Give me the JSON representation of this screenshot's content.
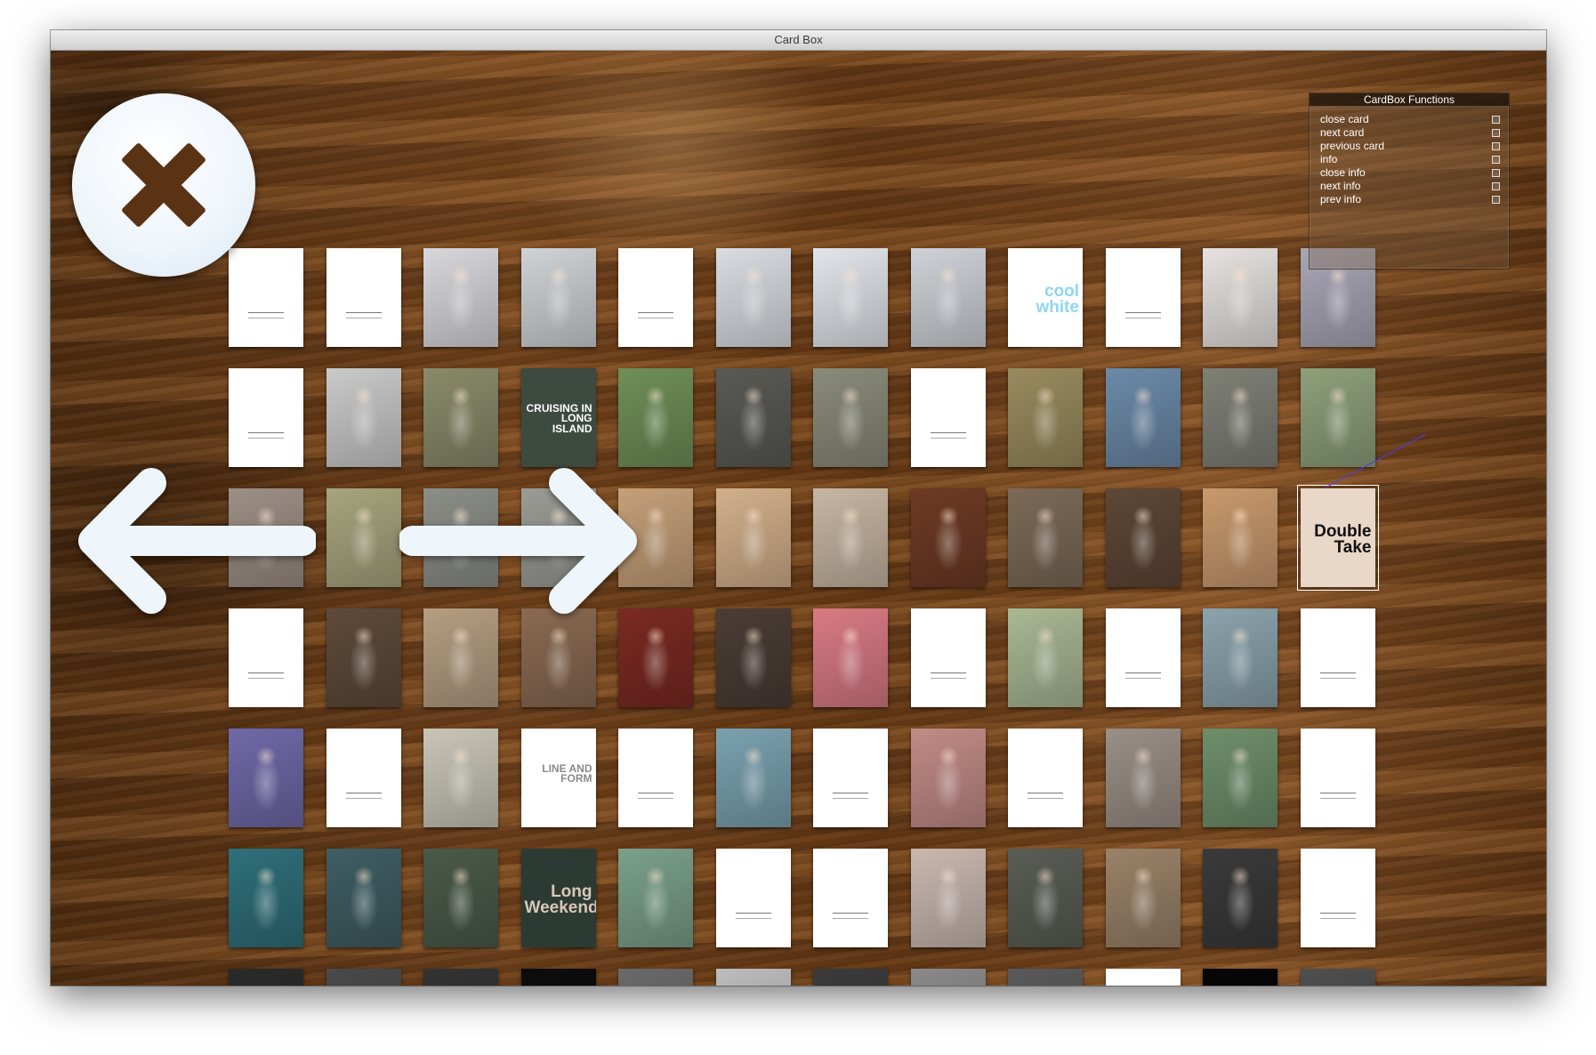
{
  "window": {
    "title": "Card Box"
  },
  "panel": {
    "title": "CardBox Functions",
    "items": [
      {
        "label": "close card"
      },
      {
        "label": "next card"
      },
      {
        "label": "previous card"
      },
      {
        "label": "info"
      },
      {
        "label": "close info"
      },
      {
        "label": "next info"
      },
      {
        "label": "prev info"
      }
    ]
  },
  "icons": {
    "close": "close-x-icon",
    "previous": "arrow-left-icon",
    "next": "arrow-right-icon",
    "status": "small-square-icon"
  },
  "colors": {
    "wood_dark": "#5a3618",
    "wood_light": "#8a5a2c",
    "button_fill": "#eef5fb",
    "x_mark": "#5a3214",
    "pen_line": "#4a3cf0"
  },
  "cards": {
    "rows": 7,
    "columns": 12,
    "selected": {
      "row": 3,
      "column": 12
    },
    "items": [
      [
        {
          "t": "blank"
        },
        {
          "t": "blank"
        },
        {
          "t": "photo",
          "c": "#d8d8dc"
        },
        {
          "t": "photo",
          "c": "#cfd3d6"
        },
        {
          "t": "blank"
        },
        {
          "t": "photo",
          "c": "#d9dde2"
        },
        {
          "t": "photo",
          "c": "#e2e5ea"
        },
        {
          "t": "photo",
          "c": "#cfd2d8"
        },
        {
          "t": "text",
          "text": "cool white",
          "col": "#8fd6f2"
        },
        {
          "t": "blank"
        },
        {
          "t": "photo",
          "c": "#e6e2e0"
        },
        {
          "t": "photo",
          "c": "#a9a6b6"
        }
      ],
      [
        {
          "t": "blank"
        },
        {
          "t": "photo",
          "c": "#cacaca"
        },
        {
          "t": "photo",
          "c": "#8a8a6a"
        },
        {
          "t": "text",
          "text": "CRUISING IN LONG ISLAND",
          "col": "#ffffff",
          "bg": "#3d4a40"
        },
        {
          "t": "photo",
          "c": "#6f8f58"
        },
        {
          "t": "photo",
          "c": "#5a5a55"
        },
        {
          "t": "photo",
          "c": "#8b8b7a"
        },
        {
          "t": "blank"
        },
        {
          "t": "photo",
          "c": "#9a8b5e"
        },
        {
          "t": "photo",
          "c": "#6b8aa8"
        },
        {
          "t": "photo",
          "c": "#7f8076"
        },
        {
          "t": "photo",
          "c": "#8ea07a"
        }
      ],
      [
        {
          "t": "photo",
          "c": "#9c8f86"
        },
        {
          "t": "photo",
          "c": "#a7a57e"
        },
        {
          "t": "photo",
          "c": "#8c8e88"
        },
        {
          "t": "photo",
          "c": "#9b9c96"
        },
        {
          "t": "photo",
          "c": "#c5a079"
        },
        {
          "t": "photo",
          "c": "#d2b08b"
        },
        {
          "t": "photo",
          "c": "#c7b6a2"
        },
        {
          "t": "photo",
          "c": "#6e3a25"
        },
        {
          "t": "photo",
          "c": "#7c6a57"
        },
        {
          "t": "photo",
          "c": "#5e4736"
        },
        {
          "t": "photo",
          "c": "#c9996d"
        },
        {
          "t": "text",
          "text": "Double Take",
          "col": "#111111",
          "bg": "#e9d7c8"
        }
      ],
      [
        {
          "t": "blank"
        },
        {
          "t": "photo",
          "c": "#5e4a3a"
        },
        {
          "t": "photo",
          "c": "#b59e82"
        },
        {
          "t": "photo",
          "c": "#8a6a52"
        },
        {
          "t": "photo",
          "c": "#7a2a22"
        },
        {
          "t": "photo",
          "c": "#4a3d36"
        },
        {
          "t": "photo",
          "c": "#d97a84"
        },
        {
          "t": "blank"
        },
        {
          "t": "photo",
          "c": "#a9b894"
        },
        {
          "t": "blank"
        },
        {
          "t": "photo",
          "c": "#8ba3ad"
        },
        {
          "t": "blank"
        }
      ],
      [
        {
          "t": "photo",
          "c": "#6f69a8"
        },
        {
          "t": "blank"
        },
        {
          "t": "photo",
          "c": "#c9c6b8"
        },
        {
          "t": "text",
          "text": "LINE AND FORM",
          "col": "#8a8a8a"
        },
        {
          "t": "blank"
        },
        {
          "t": "photo",
          "c": "#7aa1b0"
        },
        {
          "t": "blank"
        },
        {
          "t": "photo",
          "c": "#c28b86"
        },
        {
          "t": "blank"
        },
        {
          "t": "photo",
          "c": "#9a8f86"
        },
        {
          "t": "photo",
          "c": "#6e8f6a"
        },
        {
          "t": "blank"
        }
      ],
      [
        {
          "t": "photo",
          "c": "#2f6f7a"
        },
        {
          "t": "photo",
          "c": "#3f5e63"
        },
        {
          "t": "photo",
          "c": "#4a5a4a"
        },
        {
          "t": "text",
          "text": "Long Weekend",
          "col": "#d9c8b8",
          "bg": "#2c3a34"
        },
        {
          "t": "photo",
          "c": "#7aa08a"
        },
        {
          "t": "blank"
        },
        {
          "t": "blank"
        },
        {
          "t": "photo",
          "c": "#c9b8b0"
        },
        {
          "t": "photo",
          "c": "#5a5d55"
        },
        {
          "t": "photo",
          "c": "#9a8268"
        },
        {
          "t": "photo",
          "c": "#3a3a3a"
        },
        {
          "t": "blank"
        }
      ],
      [
        {
          "t": "photo",
          "c": "#2a2a2a"
        },
        {
          "t": "photo",
          "c": "#4a4a4a"
        },
        {
          "t": "photo",
          "c": "#333333"
        },
        {
          "t": "photo",
          "c": "#0c0c0c"
        },
        {
          "t": "photo",
          "c": "#6a6a6a"
        },
        {
          "t": "photo",
          "c": "#bdbdbd"
        },
        {
          "t": "photo",
          "c": "#3b3b3b"
        },
        {
          "t": "photo",
          "c": "#8a8a8a"
        },
        {
          "t": "photo",
          "c": "#5a5a5a"
        },
        {
          "t": "blank"
        },
        {
          "t": "photo",
          "c": "#050505"
        },
        {
          "t": "photo",
          "c": "#4f4f4f"
        }
      ]
    ]
  }
}
